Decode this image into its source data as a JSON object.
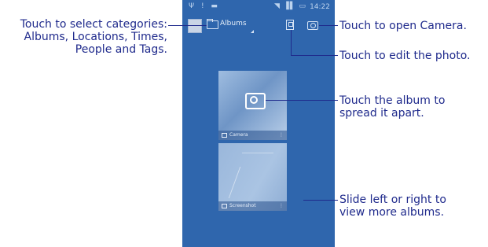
{
  "annotations": {
    "categories": [
      "Touch to select categories:",
      "Albums, Locations, Times,",
      "People and Tags."
    ],
    "open_camera": "Touch to open Camera.",
    "edit_photo": "Touch to edit the photo.",
    "spread_album": [
      "Touch the album to",
      "spread it apart."
    ],
    "slide_albums": [
      "Slide left or right to",
      "view more albums."
    ]
  },
  "status_bar": {
    "time": "14:22",
    "left_icons": "Ψ ! ▬",
    "right_icons": "◥ ▐▌ ▭"
  },
  "action_bar": {
    "category_label": "Albums"
  },
  "albums": [
    {
      "name": "Camera",
      "more": "⋮"
    },
    {
      "name": "Screenshot",
      "more": "⋮"
    }
  ],
  "icons": {
    "folder": "folder-icon",
    "edit": "edit-icon",
    "camera": "camera-icon"
  },
  "colors": {
    "background": "#2f66ad",
    "annotation": "#1f2a8c"
  }
}
